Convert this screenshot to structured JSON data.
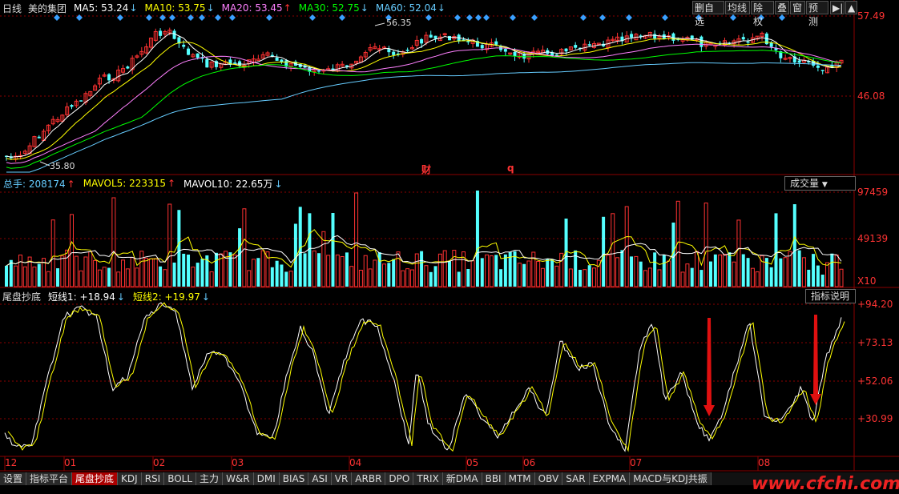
{
  "header": {
    "period": "日线",
    "name": "美的集团",
    "ma": [
      {
        "label": "MA5: 53.24",
        "arrow": "↓",
        "color": "#ffffff"
      },
      {
        "label": "MA10: 53.75",
        "arrow": "↓",
        "color": "#ffff00"
      },
      {
        "label": "MA20: 53.45",
        "arrow": "↑",
        "color": "#ff80ff"
      },
      {
        "label": "MA30: 52.75",
        "arrow": "↓",
        "color": "#00ff00"
      },
      {
        "label": "MA60: 52.04",
        "arrow": "↓",
        "color": "#66ccff"
      }
    ]
  },
  "toolbar": [
    "删自选",
    "均线",
    "除权",
    "叠",
    "窗",
    "预测"
  ],
  "price_axis": [
    "57.49",
    "46.08"
  ],
  "annotations": {
    "high": "56.35",
    "low": "35.80",
    "marker1": "财",
    "marker2": "q"
  },
  "volume_header": {
    "total": "总手: 208174",
    "total_arrow": "↑",
    "mavol5": "MAVOL5: 223315",
    "mavol5_arrow": "↑",
    "mavol10": "MAVOL10: 22.65万",
    "mavol10_arrow": "↓",
    "dropdown": "成交量"
  },
  "volume_axis": [
    "97459",
    "49139",
    "X10"
  ],
  "indicator_header": {
    "name": "尾盘抄底",
    "s1": "短线1: +18.94",
    "s1_arrow": "↓",
    "s2": "短线2: +19.97",
    "s2_arrow": "↓",
    "explain": "指标说明"
  },
  "indicator_axis": [
    "+94.20",
    "+73.13",
    "+52.06",
    "+30.99"
  ],
  "x_axis": [
    "12",
    "01",
    "02",
    "03",
    "04",
    "05",
    "06",
    "07",
    "08"
  ],
  "tabs": [
    "设置",
    "指标平台",
    "尾盘抄底",
    "KDJ",
    "RSI",
    "BOLL",
    "主力",
    "W&R",
    "DMI",
    "BIAS",
    "ASI",
    "VR",
    "ARBR",
    "DPO",
    "TRIX",
    "新DMA",
    "BBI",
    "MTM",
    "OBV",
    "SAR",
    "EXPMA",
    "MACD与KDJ共振"
  ],
  "active_tab": "尾盘抄底",
  "watermark": "www.cfchi.com",
  "colors": {
    "up": "#ff3232",
    "down": "#54ffff",
    "grid": "#8b0000",
    "text": "#dddddd"
  }
}
